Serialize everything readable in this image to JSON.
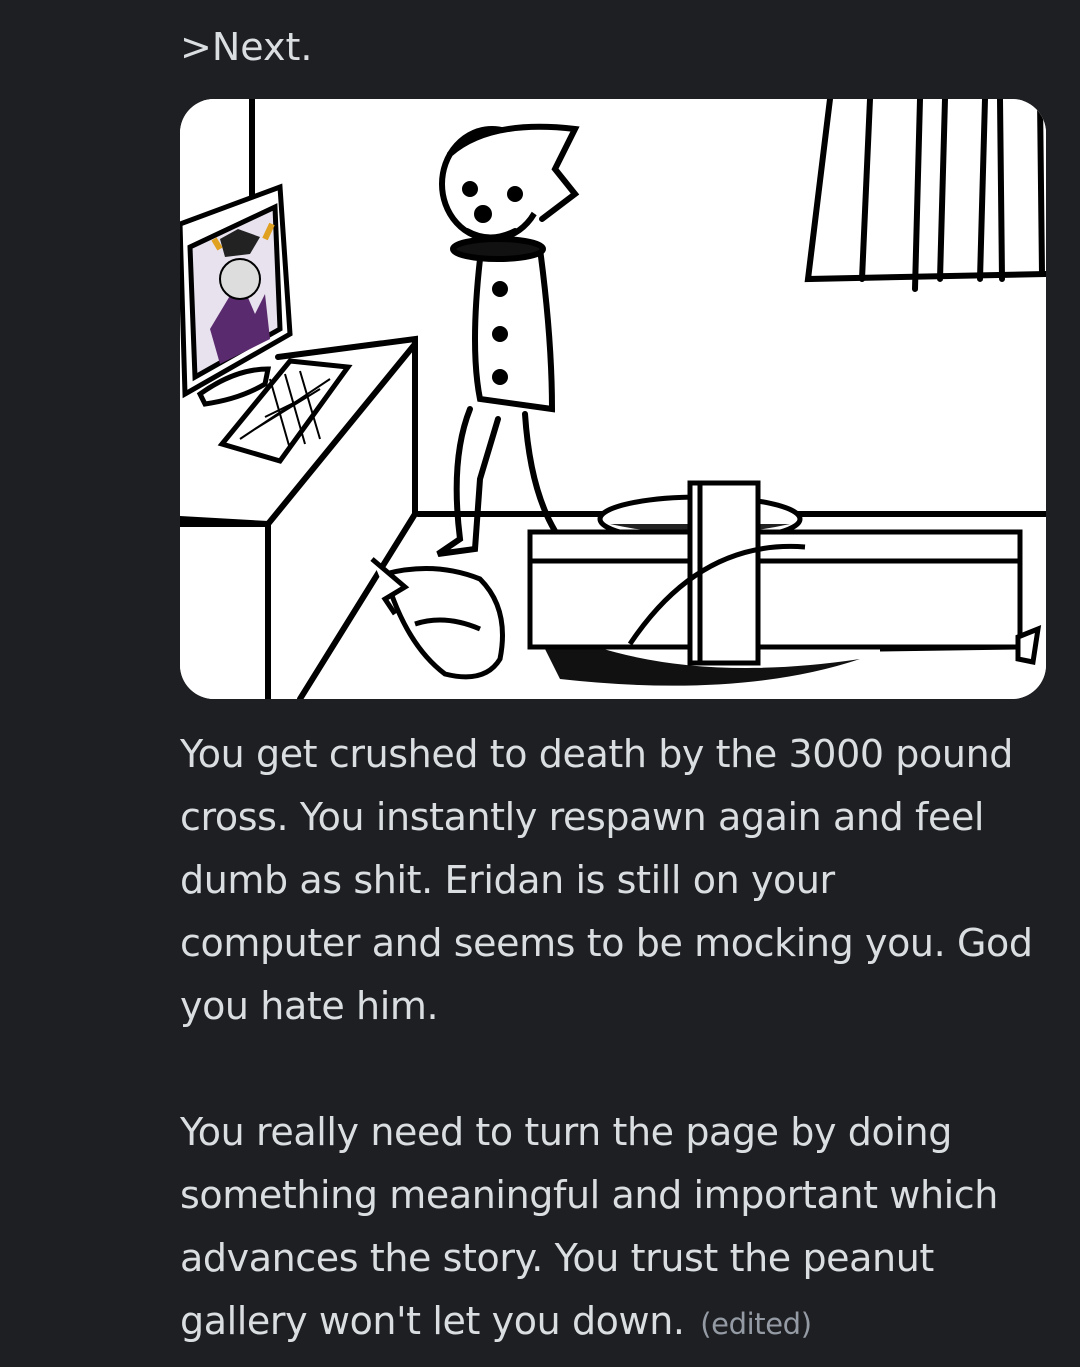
{
  "message": {
    "header_line": ">Next.",
    "attachment": {
      "alt": "comic panel"
    },
    "paragraph1": [
      "You get crushed to death by the 3000 pound",
      "cross. You instantly respawn again and feel",
      "dumb as shit. Eridan is still on your",
      "computer and seems to be mocking you. God",
      "you hate him."
    ],
    "paragraph2": [
      "You really need to turn the page by doing",
      "something meaningful and important which",
      "advances the story. You trust the peanut",
      "gallery won't let you down."
    ],
    "edited_label": "(edited)"
  },
  "colors": {
    "background": "#1e1f22",
    "text": "#dbdee1",
    "muted": "#949ba4"
  }
}
